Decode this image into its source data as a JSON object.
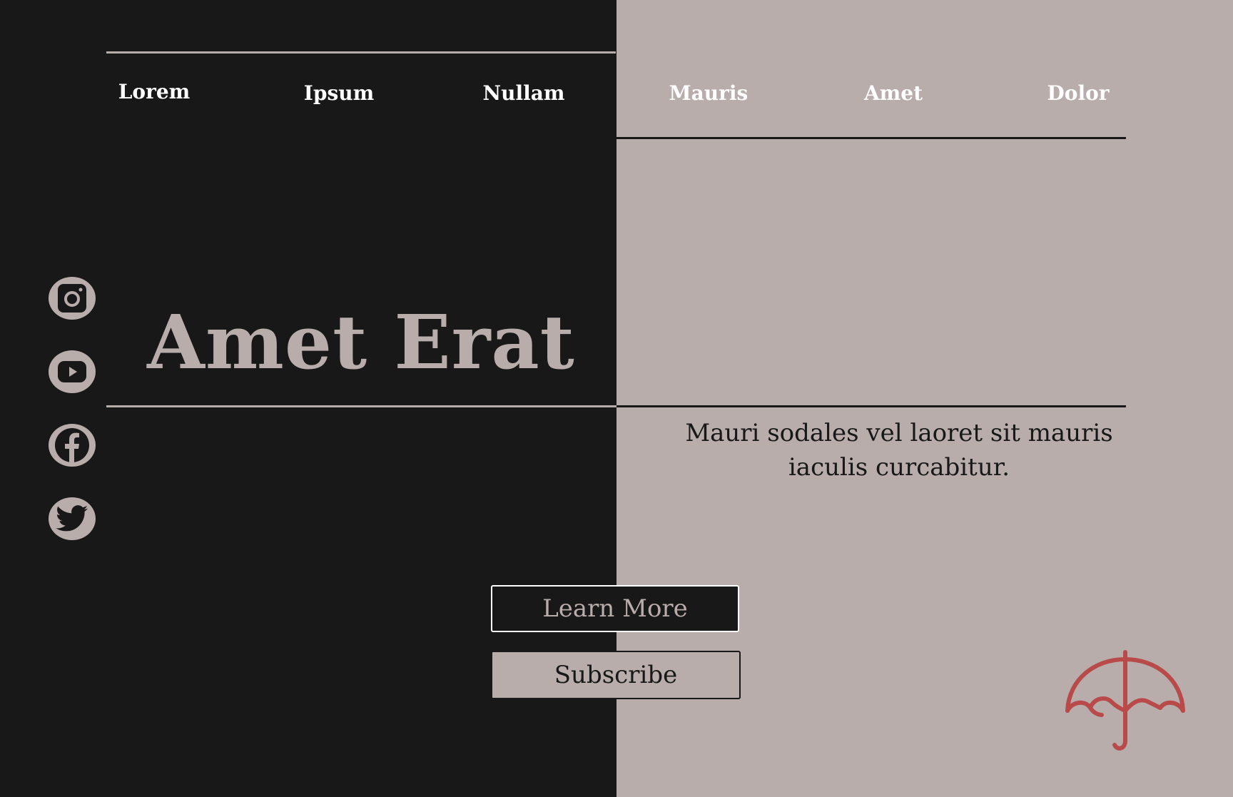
{
  "nav": {
    "items": [
      {
        "label": "Lorem"
      },
      {
        "label": "Ipsum"
      },
      {
        "label": "Nullam"
      },
      {
        "label": "Mauris"
      },
      {
        "label": "Amet"
      },
      {
        "label": "Dolor"
      }
    ]
  },
  "social": {
    "icons": [
      "instagram-icon",
      "youtube-icon",
      "facebook-icon",
      "twitter-icon"
    ]
  },
  "hero": {
    "title": "Amet Erat"
  },
  "tagline": {
    "line1": "Mauri sodales vel laoret sit mauris",
    "line2": "iaculis curcabitur."
  },
  "buttons": {
    "learn_more": "Learn More",
    "subscribe": "Subscribe"
  },
  "colors": {
    "dark": "#181818",
    "light": "#b8adaa",
    "accent": "#b94a4a",
    "white": "#ffffff"
  },
  "decor": {
    "umbrella_icon": "umbrella-icon"
  }
}
